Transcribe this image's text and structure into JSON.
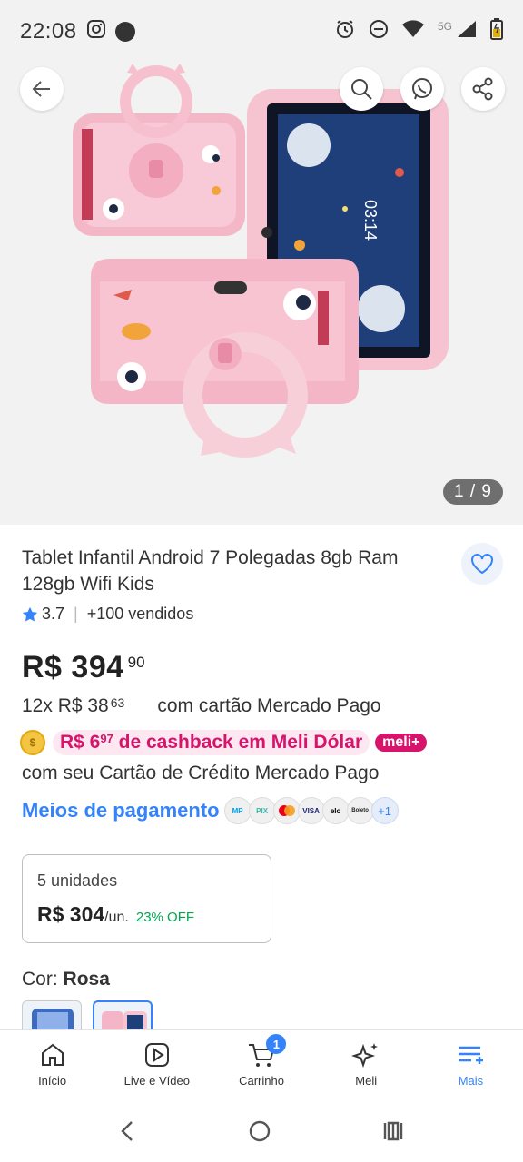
{
  "status_bar": {
    "time": "22:08",
    "network_label": "5G"
  },
  "gallery": {
    "counter": "1 / 9",
    "screen_time": "03:14"
  },
  "product": {
    "title": "Tablet Infantil Android 7 Polegadas 8gb Ram 128gb Wifi Kids",
    "rating": "3.7",
    "sold": "+100 vendidos",
    "price_main": "R$ 394",
    "price_cents": "90",
    "installments_prefix": "12x R$ 38",
    "installments_cents": "63",
    "installments_suffix": "com cartão Mercado Pago",
    "cashback_prefix": "R$ 6",
    "cashback_cents": "97",
    "cashback_suffix": " de cashback em Meli Dólar",
    "meli_badge": "meli+",
    "card_line": "com seu Cartão de Crédito Mercado Pago",
    "payment_link": "Meios de pagamento",
    "payment_icons": [
      "MP",
      "PIX",
      "MC",
      "VISA",
      "elo",
      "Boleto"
    ],
    "payment_more": "+1",
    "bulk": {
      "units": "5 unidades",
      "price": "R$ 304",
      "per_unit": "/un.",
      "discount": "23% OFF"
    },
    "color_label": "Cor:",
    "color_value": "Rosa"
  },
  "tabs": [
    {
      "label": "Início",
      "icon": "home-icon"
    },
    {
      "label": "Live e Vídeo",
      "icon": "play-icon"
    },
    {
      "label": "Carrinho",
      "icon": "cart-icon",
      "badge": "1"
    },
    {
      "label": "Meli",
      "icon": "sparkle-icon"
    },
    {
      "label": "Mais",
      "icon": "menu-icon",
      "active": true
    }
  ],
  "colors": {
    "accent": "#3483fa",
    "cashback": "#d6146b",
    "discount": "#00a650"
  }
}
